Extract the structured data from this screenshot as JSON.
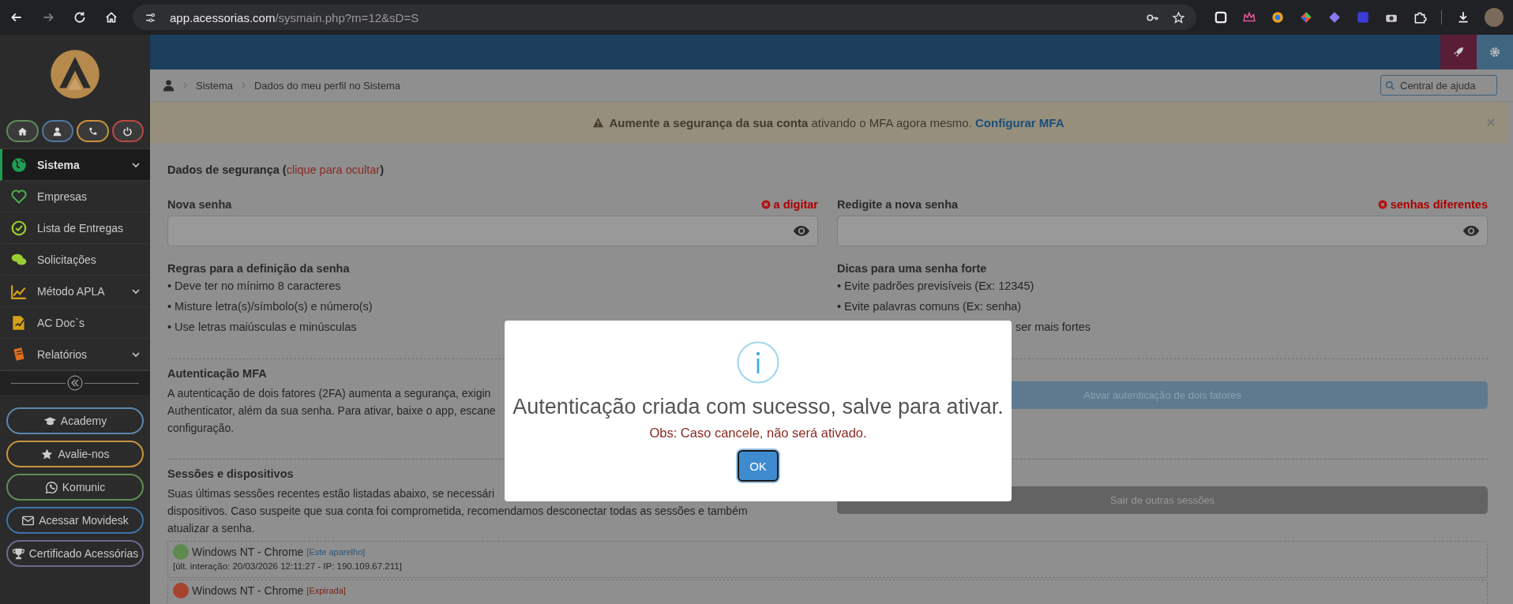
{
  "browser": {
    "url_host": "app.acessorias.com",
    "url_path": "/sysmain.php?m=12&sD=S"
  },
  "sidebar": {
    "quick_buttons": [
      {
        "color": "#5f8a5a"
      },
      {
        "color": "#4f78a0"
      },
      {
        "color": "#c7913a"
      },
      {
        "color": "#b84a45"
      }
    ],
    "menu": [
      {
        "label": "Sistema",
        "selected": true,
        "submenu": true
      },
      {
        "label": "Empresas",
        "selected": false,
        "submenu": false
      },
      {
        "label": "Lista de Entregas",
        "selected": false,
        "submenu": false
      },
      {
        "label": "Solicitações",
        "selected": false,
        "submenu": false
      },
      {
        "label": "Método APLA",
        "selected": false,
        "submenu": true
      },
      {
        "label": "AC Doc`s",
        "selected": false,
        "submenu": false
      },
      {
        "label": "Relatórios",
        "selected": false,
        "submenu": true
      }
    ],
    "pills": [
      {
        "label": "Academy",
        "color": "#5b87ad"
      },
      {
        "label": "Avalie-nos",
        "color": "#c8943f"
      },
      {
        "label": "Komunic",
        "color": "#5f8d55"
      },
      {
        "label": "Acessar Movidesk",
        "color": "#3f72a8"
      },
      {
        "label": "Certificado Acessórias",
        "color": "#6c6a8e"
      }
    ]
  },
  "breadcrumb": [
    "Sistema",
    "Dados do meu perfil no Sistema"
  ],
  "help_search": {
    "placeholder": "Central de ajuda"
  },
  "banner": {
    "text": "**Aumente a segurança da sua conta** ativando o MFA agora mesmo.",
    "link": "Configurar MFA"
  },
  "security": {
    "prefix": "Dados de segurança (",
    "link": "clique para ocultar",
    "suffix": ")"
  },
  "fields": [
    {
      "label": "Nova senha",
      "status": "a digitar"
    },
    {
      "label": "Redigite a nova senha",
      "status": "senhas diferentes"
    }
  ],
  "rules": {
    "title": "Regras para a definição da senha",
    "items": [
      "• Deve ter no mínimo 8 caracteres",
      "• Misture letra(s)/símbolo(s) e número(s)",
      "• Use letras maiúsculas e minúsculas"
    ]
  },
  "tips": {
    "title": "Dicas para uma senha forte",
    "items": [
      "• Evite padrões previsíveis (Ex: 12345)",
      "• Evite palavras comuns (Ex: senha)"
    ],
    "partial_item": "ser mais fortes"
  },
  "mfa": {
    "title": "Autenticação MFA",
    "lines": [
      "A autenticação de dois fatores (2FA) aumenta a segurança, exigin",
      "Authenticator, além da sua senha. Para ativar, baixe o app, escane",
      "configuração."
    ],
    "button": "Ativar autenticação de dois fatores",
    "disabled": true
  },
  "sessions": {
    "title": "Sessões e dispositivos",
    "lines": [
      "Suas últimas sessões recentes estão listadas abaixo, se necessári",
      "dispositivos. Caso suspeite que sua conta foi comprometida, recomendamos desconectar todas as sessões e também",
      "atualizar a senha."
    ],
    "button": "Sair de outras sessões",
    "devices": [
      {
        "name": "Windows NT - Chrome",
        "tag": "[Este aparelho]",
        "expired": false,
        "color": "#5e8a4f",
        "detail": "[últ. interação: 20/03/2026 12:11:27 - IP: 190.109.67.211]"
      },
      {
        "name": "Windows NT - Chrome",
        "tag": "[Expirada]",
        "expired": true,
        "color": "#a8432f"
      }
    ]
  },
  "modal": {
    "title": "Autenticação criada com sucesso, salve para ativar.",
    "note": "Obs: Caso cancele, não será ativado.",
    "button": "OK"
  }
}
